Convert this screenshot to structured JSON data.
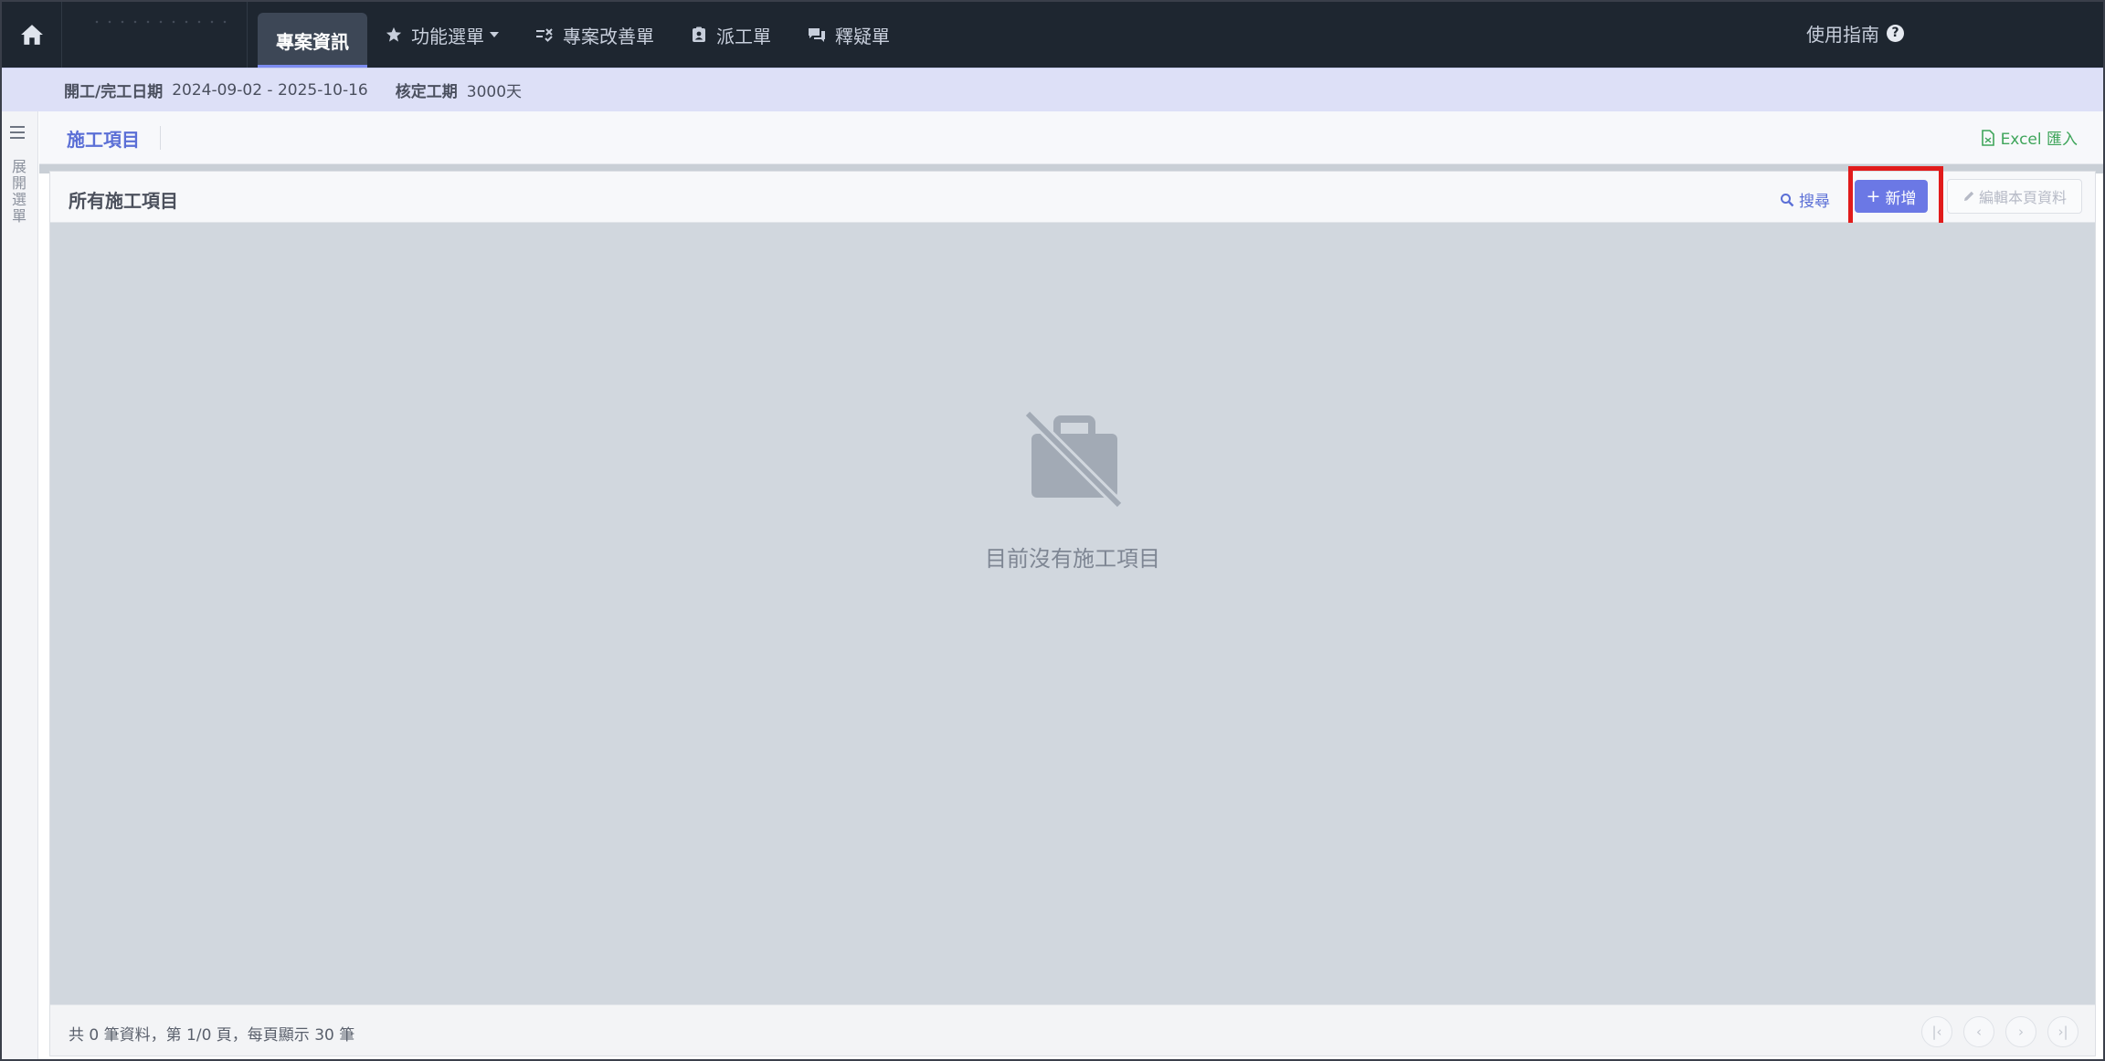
{
  "topbar": {
    "nav": [
      {
        "label": "專案資訊",
        "icon": "none",
        "active": true
      },
      {
        "label": "功能選單",
        "icon": "star-icon"
      },
      {
        "label": "專案改善單",
        "icon": "checklist-icon"
      },
      {
        "label": "派工單",
        "icon": "badge-icon"
      },
      {
        "label": "釋疑單",
        "icon": "chat-icon"
      }
    ],
    "guide_label": "使用指南"
  },
  "info": {
    "date_label": "開工/完工日期",
    "date_value": "2024-09-02 - 2025-10-16",
    "duration_label": "核定工期",
    "duration_value": "3000天"
  },
  "sidebar": {
    "expand_label": "展開選單"
  },
  "page": {
    "title": "施工項目",
    "excel_label": "Excel 匯入"
  },
  "card": {
    "title": "所有施工項目",
    "search_label": "搜尋",
    "add_label": "新增",
    "edit_label": "編輯本頁資料",
    "empty_text": "目前沒有施工項目",
    "footer_text": "共 0 筆資料，第 1/0 頁，每頁顯示 30 筆"
  },
  "colors": {
    "accent": "#6b78e5",
    "highlight": "#e11b1b",
    "excel": "#3fa55b"
  }
}
